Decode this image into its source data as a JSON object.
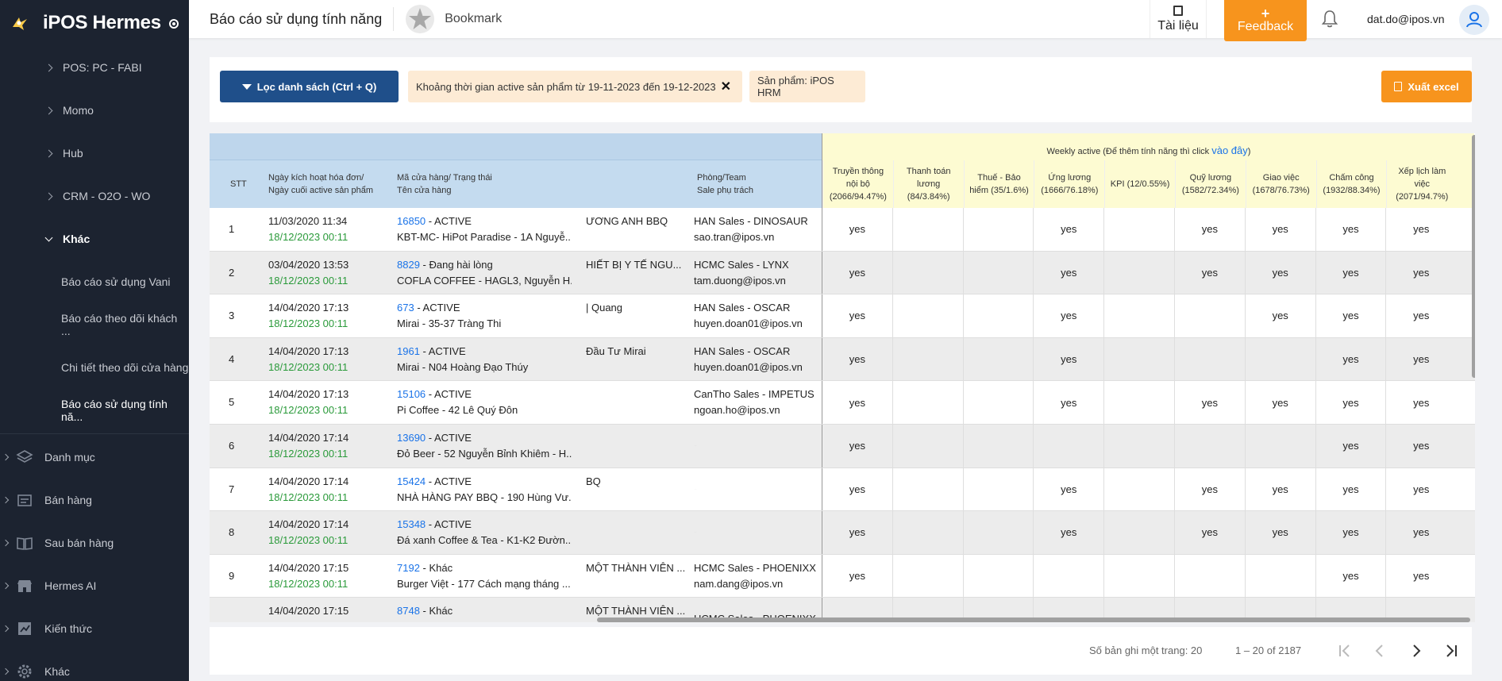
{
  "app": {
    "name": "iPOS Hermes"
  },
  "sidebar": {
    "sub_items": [
      "POS: PC - FABI",
      "Momo",
      "Hub",
      "CRM - O2O - WO",
      "Khác"
    ],
    "sub2_items": [
      "Báo cáo sử dụng Vani",
      "Báo cáo theo dõi khách ...",
      "Chi tiết theo dõi cửa hàng",
      "Báo cáo sử dụng tính nă..."
    ],
    "main_items": [
      {
        "label": "Danh mục",
        "icon": "layers-icon"
      },
      {
        "label": "Bán hàng",
        "icon": "cart-icon"
      },
      {
        "label": "Sau bán hàng",
        "icon": "book-open-icon"
      },
      {
        "label": "Hermes AI",
        "icon": "store-icon"
      },
      {
        "label": "Kiến thức",
        "icon": "chart-edit-icon"
      },
      {
        "label": "Khác",
        "icon": "gear-icon"
      }
    ]
  },
  "header": {
    "title": "Báo cáo sử dụng tính năng",
    "bookmark": "Bookmark",
    "docs": "Tài liệu",
    "feedback_plus": "+",
    "feedback": "Feedback",
    "user": "dat.do@ipos.vn"
  },
  "filters": {
    "filter_button": "Lọc danh sách (Ctrl + Q)",
    "chip_date": "Khoảng thời gian active sản phẩm từ 19-11-2023 đến 19-12-2023",
    "chip_date_close": "✕",
    "chip_product": "Sản phẩm: iPOS HRM",
    "export_button": "Xuất excel"
  },
  "table": {
    "headers": {
      "stt": "STT",
      "date_line1": "Ngày kích hoạt hóa đơn/",
      "date_line2": "Ngày cuối active sản phẩm",
      "store_line1": "Mã cửa hàng/ Trạng thái",
      "store_line2": "Tên cửa hàng",
      "team_line1": "Phòng/Team",
      "team_line2": "Sale phụ trách",
      "weekly_prefix": "Weekly active (Để thêm tính năng thì click ",
      "weekly_link": "vào đây",
      "weekly_suffix": ")"
    },
    "features": [
      [
        "Truyền thông",
        "nội bộ",
        "(2066/94.47%)"
      ],
      [
        "Thanh toán",
        "lương",
        "(84/3.84%)"
      ],
      [
        "Thuế - Bảo",
        "hiểm (35/1.6%)",
        ""
      ],
      [
        "Ứng lương",
        "(1666/76.18%)",
        ""
      ],
      [
        "KPI (12/0.55%)",
        "",
        ""
      ],
      [
        "Quỹ lương",
        "(1582/72.34%)",
        ""
      ],
      [
        "Giao việc",
        "(1678/76.73%)",
        ""
      ],
      [
        "Chấm công",
        "(1932/88.34%)",
        ""
      ],
      [
        "Xếp lịch làm",
        "việc",
        "(2071/94.7%)"
      ]
    ],
    "rows": [
      {
        "stt": "1",
        "date1": "11/03/2020 11:34",
        "date2": "18/12/2023 00:11",
        "code": "16850",
        "status": " - ACTIVE",
        "name": "KBT-MC- HiPot Paradise - 1A Nguyễ...",
        "partial": "ƯƠNG ANH BBQ",
        "team": "HAN Sales - DINOSAUR",
        "sale": "sao.tran@ipos.vn",
        "feats": [
          "yes",
          "",
          "",
          "yes",
          "",
          "yes",
          "yes",
          "yes",
          "yes"
        ]
      },
      {
        "stt": "2",
        "date1": "03/04/2020 13:53",
        "date2": "18/12/2023 00:11",
        "code": "8829",
        "status": " - Đang hài lòng",
        "name": "COFLA COFFEE - HAGL3, Nguyễn H...",
        "partial": "HIẾT BỊ Y TẾ NGU...",
        "team": "HCMC Sales - LYNX",
        "sale": "tam.duong@ipos.vn",
        "feats": [
          "yes",
          "",
          "",
          "yes",
          "",
          "yes",
          "yes",
          "yes",
          "yes"
        ]
      },
      {
        "stt": "3",
        "date1": "14/04/2020 17:13",
        "date2": "18/12/2023 00:11",
        "code": "673",
        "status": " - ACTIVE",
        "name": "Mirai - 35-37 Tràng Thi",
        "partial": "| Quang",
        "team": "HAN Sales - OSCAR",
        "sale": "huyen.doan01@ipos.vn",
        "feats": [
          "yes",
          "",
          "",
          "yes",
          "",
          "",
          "yes",
          "yes",
          "yes"
        ]
      },
      {
        "stt": "4",
        "date1": "14/04/2020 17:13",
        "date2": "18/12/2023 00:11",
        "code": "1961",
        "status": " - ACTIVE",
        "name": "Mirai - N04 Hoàng Đạo Thúy",
        "partial": "Đầu Tư Mirai",
        "team": "HAN Sales - OSCAR",
        "sale": "huyen.doan01@ipos.vn",
        "feats": [
          "yes",
          "",
          "",
          "yes",
          "",
          "",
          "",
          "yes",
          "yes"
        ]
      },
      {
        "stt": "5",
        "date1": "14/04/2020 17:13",
        "date2": "18/12/2023 00:11",
        "code": "15106",
        "status": " - ACTIVE",
        "name": "Pi Coffee - 42 Lê Quý Đôn",
        "partial": "",
        "team": "CanTho Sales - IMPETUS",
        "sale": "ngoan.ho@ipos.vn",
        "feats": [
          "yes",
          "",
          "",
          "yes",
          "",
          "yes",
          "yes",
          "yes",
          "yes"
        ]
      },
      {
        "stt": "6",
        "date1": "14/04/2020 17:14",
        "date2": "18/12/2023 00:11",
        "code": "13690",
        "status": " - ACTIVE",
        "name": "Đỏ Beer - 52 Nguyễn Bỉnh Khiêm - H...",
        "partial": "",
        "team": "-",
        "sale": "",
        "feats": [
          "yes",
          "",
          "",
          "",
          "",
          "",
          "",
          "yes",
          "yes"
        ]
      },
      {
        "stt": "7",
        "date1": "14/04/2020 17:14",
        "date2": "18/12/2023 00:11",
        "code": "15424",
        "status": " - ACTIVE",
        "name": "NHÀ HÀNG PAY BBQ - 190 Hùng Vư...",
        "partial": "BQ",
        "team": "-",
        "sale": "",
        "feats": [
          "yes",
          "",
          "",
          "yes",
          "",
          "yes",
          "yes",
          "yes",
          "yes"
        ]
      },
      {
        "stt": "8",
        "date1": "14/04/2020 17:14",
        "date2": "18/12/2023 00:11",
        "code": "15348",
        "status": " - ACTIVE",
        "name": "Đá xanh Coffee & Tea - K1-K2 Đườn...",
        "partial": "",
        "team": "-",
        "sale": "",
        "feats": [
          "yes",
          "",
          "",
          "yes",
          "",
          "yes",
          "yes",
          "yes",
          "yes"
        ]
      },
      {
        "stt": "9",
        "date1": "14/04/2020 17:15",
        "date2": "18/12/2023 00:11",
        "code": "7192",
        "status": " - Khác",
        "name": "Burger Việt - 177 Cách mạng tháng ...",
        "partial": "MỘT THÀNH VIÊN ...",
        "team": "HCMC Sales - PHOENIXX",
        "sale": "nam.dang@ipos.vn",
        "feats": [
          "yes",
          "",
          "",
          "",
          "",
          "",
          "",
          "yes",
          "yes"
        ]
      },
      {
        "stt": "",
        "date1": "14/04/2020 17:15",
        "date2": "",
        "code": "8748",
        "status": " - Khác",
        "name": "",
        "partial": "MỘT THÀNH VIÊN ...",
        "team": "HCMC Sales - PHOENIXX",
        "sale": "",
        "feats": [
          "",
          "",
          "",
          "",
          "",
          "",
          "",
          "",
          ""
        ]
      }
    ]
  },
  "pager": {
    "page_size": "Số bản ghi một trang: 20",
    "range": "1 – 20 of 2187"
  }
}
